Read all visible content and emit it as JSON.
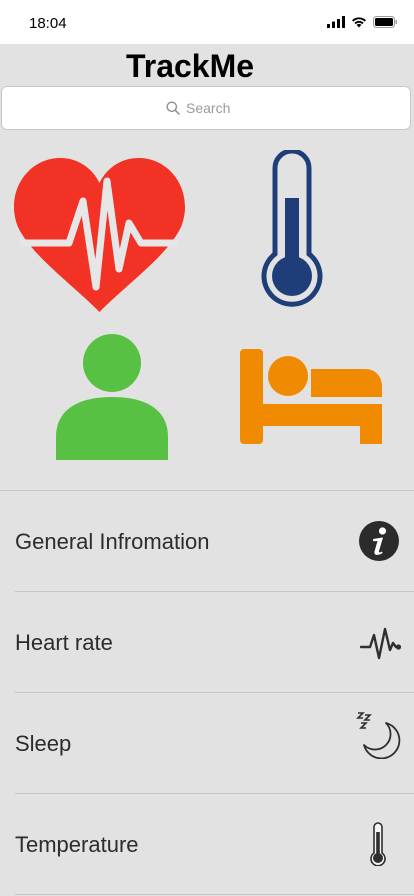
{
  "status_bar": {
    "time": "18:04",
    "icons": [
      "cellular-signal-icon",
      "wifi-icon",
      "battery-icon"
    ]
  },
  "header": {
    "title": "TrackMe"
  },
  "search": {
    "placeholder": "Search",
    "value": ""
  },
  "tiles": [
    {
      "name": "heart-rate-tile",
      "icon": "heartbeat-heart-icon",
      "color": "#f23224"
    },
    {
      "name": "temperature-tile",
      "icon": "thermometer-icon",
      "color": "#1f3d78"
    },
    {
      "name": "profile-tile",
      "icon": "person-icon",
      "color": "#58c144"
    },
    {
      "name": "sleep-tile",
      "icon": "bed-icon",
      "color": "#f08a00"
    }
  ],
  "list": {
    "items": [
      {
        "label": "General Infromation",
        "icon": "info-icon"
      },
      {
        "label": "Heart rate",
        "icon": "pulse-icon"
      },
      {
        "label": "Sleep",
        "icon": "moon-zzz-icon"
      },
      {
        "label": "Temperature",
        "icon": "thermometer-small-icon"
      }
    ]
  },
  "colors": {
    "background": "#e2e2e2",
    "heart": "#f23224",
    "thermometer": "#1f3d78",
    "person": "#58c144",
    "bed": "#f08a00"
  }
}
